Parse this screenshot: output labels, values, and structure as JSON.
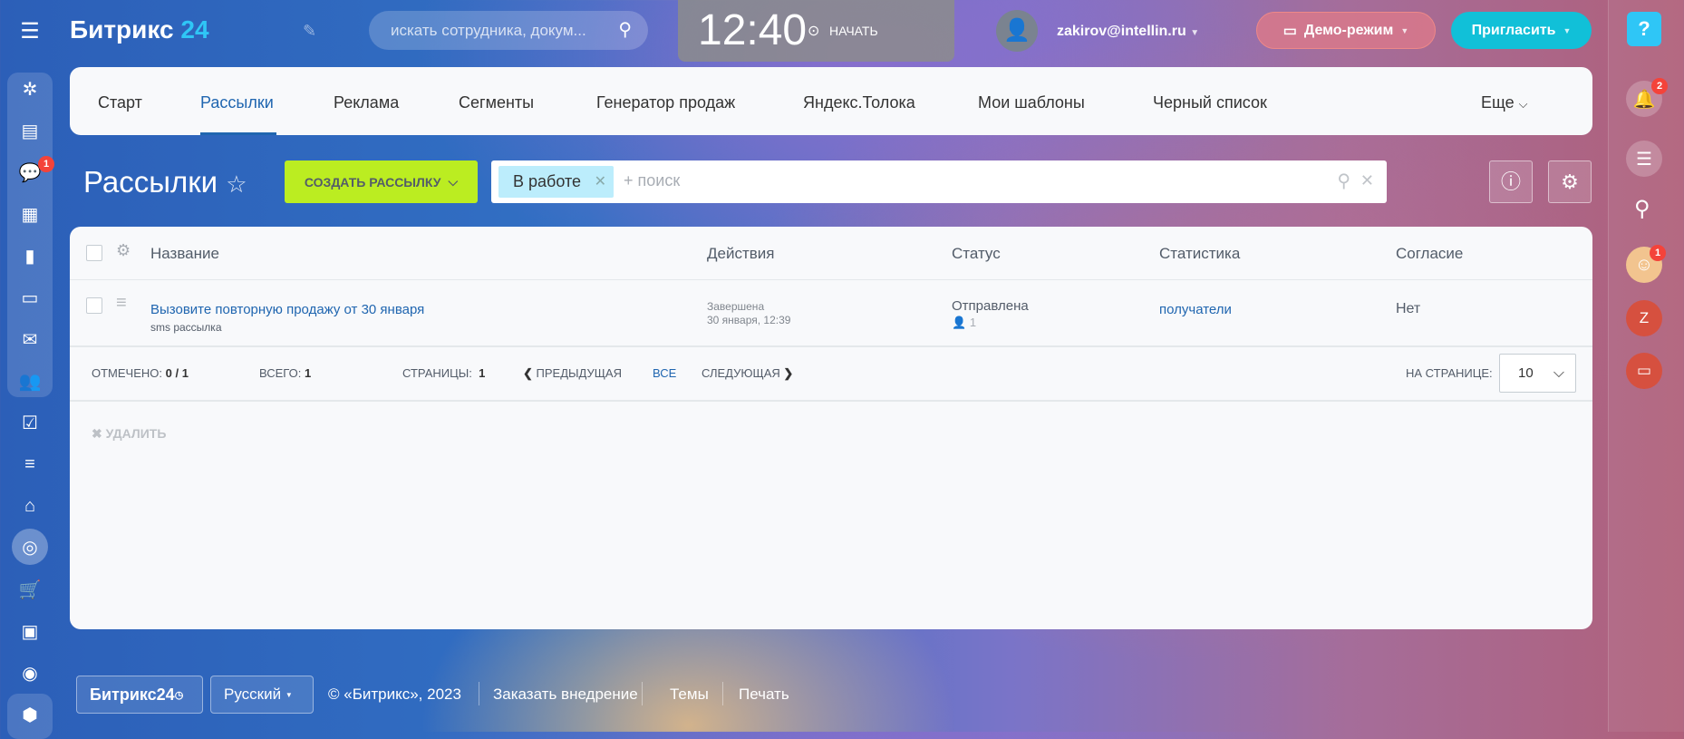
{
  "header": {
    "logo_text": "Битрикс",
    "logo_num": "24",
    "search_placeholder": "искать сотрудника, докум...",
    "clock": "12:40",
    "start_label": "НАЧАТЬ",
    "user_email": "zakirov@intellin.ru",
    "demo_label": "Демо-режим",
    "invite_label": "Пригласить"
  },
  "leftbar": {
    "chat_badge": "1"
  },
  "rightbar": {
    "notif_badge": "2",
    "avatar_badge": "1",
    "user_initial": "Z"
  },
  "tabs": [
    {
      "label": "Старт"
    },
    {
      "label": "Рассылки",
      "active": true
    },
    {
      "label": "Реклама"
    },
    {
      "label": "Сегменты"
    },
    {
      "label": "Генератор продаж"
    },
    {
      "label": "Яндекс.Толока"
    },
    {
      "label": "Мои шаблоны"
    },
    {
      "label": "Черный список"
    }
  ],
  "tabs_more": "Еще",
  "page": {
    "title": "Рассылки",
    "create_button": "СОЗДАТЬ РАССЫЛКУ",
    "filter_tag": "В работе",
    "filter_placeholder": "+ поиск"
  },
  "table": {
    "columns": [
      "Название",
      "Действия",
      "Статус",
      "Статистика",
      "Согласие"
    ],
    "rows": [
      {
        "name": "Вызовите повторную продажу от 30 января",
        "type": "sms рассылка",
        "action_status": "Завершена",
        "action_date": "30 января, 12:39",
        "status": "Отправлена",
        "recipients_count": "1",
        "stats_link": "получатели",
        "consent": "Нет"
      }
    ]
  },
  "footer_bar": {
    "checked_label": "ОТМЕЧЕНО:",
    "checked_value": "0 / 1",
    "total_label": "ВСЕГО:",
    "total_value": "1",
    "pages_label": "СТРАНИЦЫ:",
    "pages_value": "1",
    "prev": "ПРЕДЫДУЩАЯ",
    "all": "ВСЕ",
    "next": "СЛЕДУЮЩАЯ",
    "per_page_label": "НА СТРАНИЦЕ:",
    "per_page_value": "10"
  },
  "delete_label": "УДАЛИТЬ",
  "footer": {
    "brand": "Битрикс24",
    "language": "Русский",
    "copyright": "© «Битрикс», 2023",
    "order": "Заказать внедрение",
    "themes": "Темы",
    "print": "Печать"
  },
  "colors": {
    "accent": "#2066b0",
    "create": "#bbed21",
    "invite": "#11c0d8",
    "demo": "#d47a8c"
  }
}
